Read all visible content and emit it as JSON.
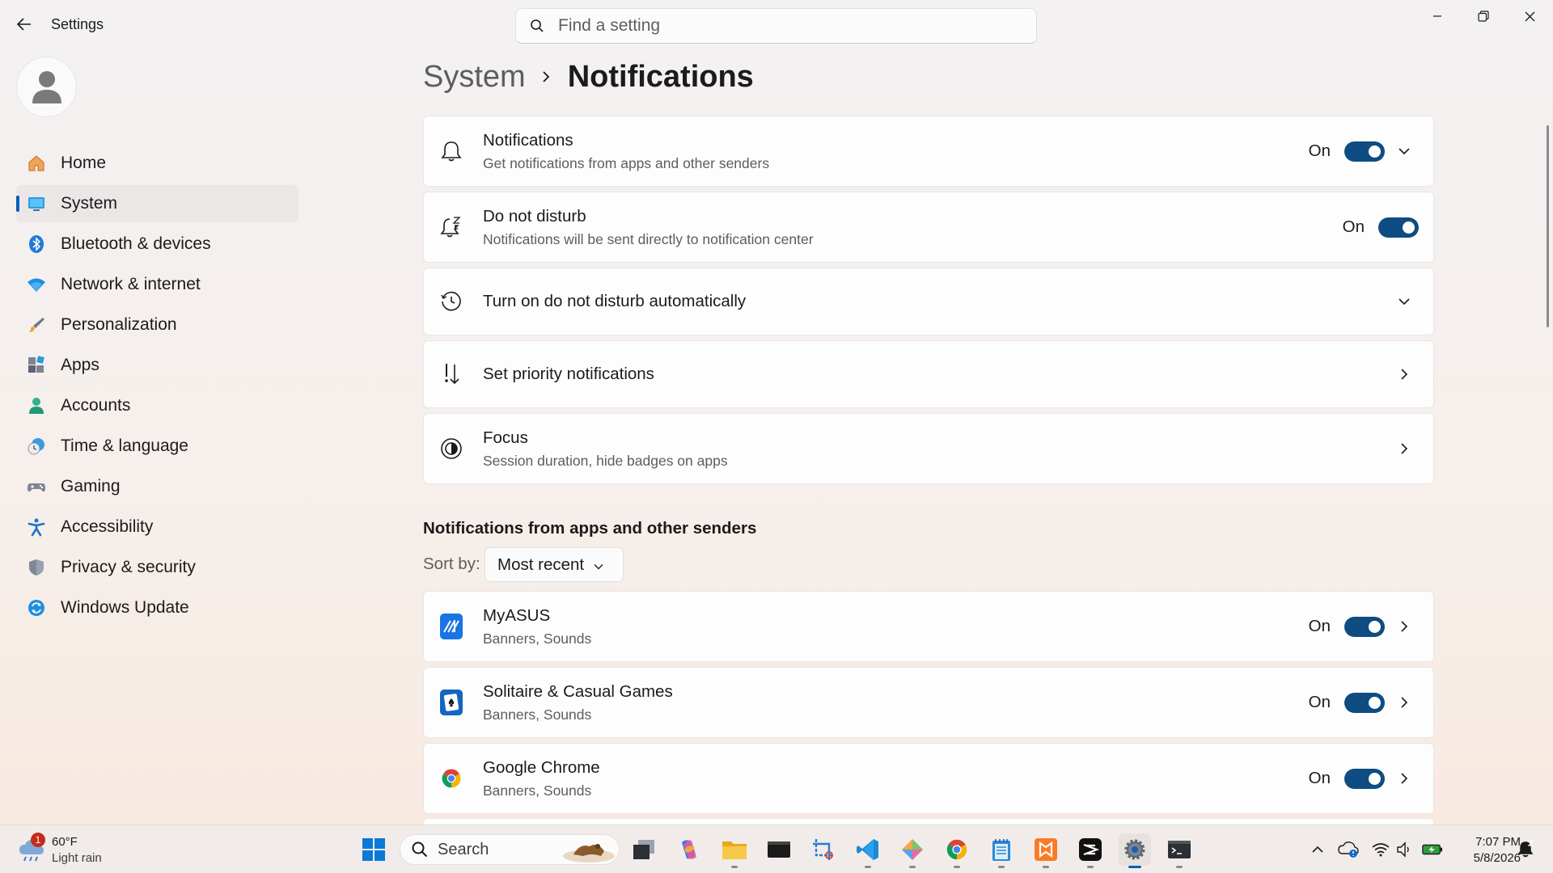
{
  "app": {
    "title": "Settings"
  },
  "search": {
    "placeholder": "Find a setting"
  },
  "sidebar": {
    "items": [
      {
        "label": "Home",
        "icon": "home-icon"
      },
      {
        "label": "System",
        "icon": "system-icon",
        "active": true
      },
      {
        "label": "Bluetooth & devices",
        "icon": "bluetooth-icon"
      },
      {
        "label": "Network & internet",
        "icon": "wifi-icon"
      },
      {
        "label": "Personalization",
        "icon": "brush-icon"
      },
      {
        "label": "Apps",
        "icon": "apps-icon"
      },
      {
        "label": "Accounts",
        "icon": "accounts-icon"
      },
      {
        "label": "Time & language",
        "icon": "clock-globe-icon"
      },
      {
        "label": "Gaming",
        "icon": "gamepad-icon"
      },
      {
        "label": "Accessibility",
        "icon": "accessibility-icon"
      },
      {
        "label": "Privacy & security",
        "icon": "shield-icon"
      },
      {
        "label": "Windows Update",
        "icon": "update-icon"
      }
    ]
  },
  "breadcrumb": {
    "parent": "System",
    "current": "Notifications"
  },
  "settings": {
    "notifications": {
      "title": "Notifications",
      "subtitle": "Get notifications from apps and other senders",
      "state": "On",
      "enabled": true
    },
    "dnd": {
      "title": "Do not disturb",
      "subtitle": "Notifications will be sent directly to notification center",
      "state": "On",
      "enabled": true
    },
    "auto_dnd": {
      "title": "Turn on do not disturb automatically"
    },
    "priority": {
      "title": "Set priority notifications"
    },
    "focus": {
      "title": "Focus",
      "subtitle": "Session duration, hide badges on apps"
    }
  },
  "apps_section": {
    "title": "Notifications from apps and other senders",
    "sort_label": "Sort by:",
    "sort_value": "Most recent",
    "apps": [
      {
        "name": "MyASUS",
        "detail": "Banners, Sounds",
        "state": "On",
        "enabled": true
      },
      {
        "name": "Solitaire & Casual Games",
        "detail": "Banners, Sounds",
        "state": "On",
        "enabled": true
      },
      {
        "name": "Google Chrome",
        "detail": "Banners, Sounds",
        "state": "On",
        "enabled": true
      }
    ]
  },
  "taskbar": {
    "weather": {
      "temp": "60°F",
      "condition": "Light rain",
      "badge": "1"
    },
    "search_label": "Search",
    "time": "7:07 PM",
    "date": "5/8/2026"
  },
  "colors": {
    "accent": "#005fb8",
    "toggle_on": "#0f4c81"
  }
}
